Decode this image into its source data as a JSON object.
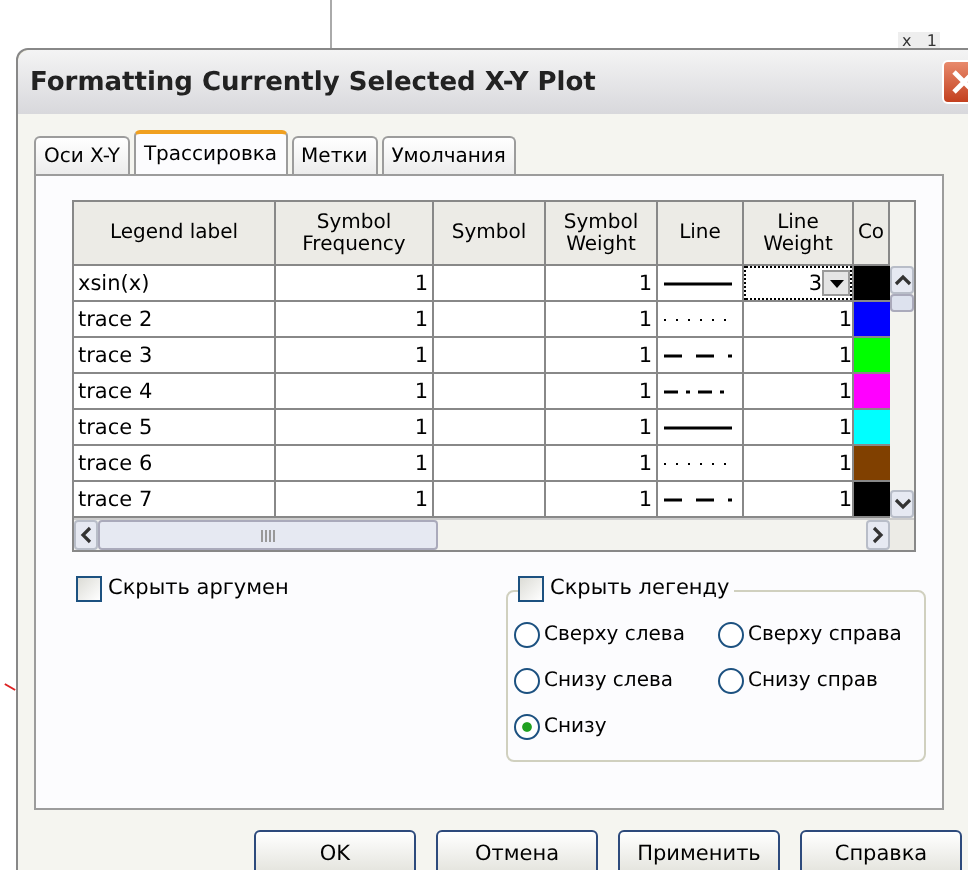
{
  "background": {
    "corner_text": "x   1"
  },
  "window": {
    "title": "Formatting Currently Selected X-Y Plot"
  },
  "tabs": [
    {
      "label": "Оси X-Y",
      "selected": false
    },
    {
      "label": "Трассировка",
      "selected": true
    },
    {
      "label": "Метки",
      "selected": false
    },
    {
      "label": "Умолчания",
      "selected": false
    }
  ],
  "table": {
    "columns": [
      "Legend label",
      "Symbol Frequency",
      "Symbol",
      "Symbol Weight",
      "Line",
      "Line Weight",
      "Co"
    ],
    "rows": [
      {
        "legend_label": "xsin(x)",
        "symbol_frequency": "1",
        "symbol_weight": "1",
        "kind": "solid",
        "line_weight": "3",
        "editing": true,
        "color": "#000000"
      },
      {
        "legend_label": "trace 2",
        "symbol_frequency": "1",
        "symbol_weight": "1",
        "kind": "dotted",
        "line_weight": "1",
        "editing": false,
        "color": "#0000ff"
      },
      {
        "legend_label": "trace 3",
        "symbol_frequency": "1",
        "symbol_weight": "1",
        "kind": "dashed",
        "line_weight": "1",
        "editing": false,
        "color": "#00ff00"
      },
      {
        "legend_label": "trace 4",
        "symbol_frequency": "1",
        "symbol_weight": "1",
        "kind": "dashdot",
        "line_weight": "1",
        "editing": false,
        "color": "#ff00ff"
      },
      {
        "legend_label": "trace 5",
        "symbol_frequency": "1",
        "symbol_weight": "1",
        "kind": "solid",
        "line_weight": "1",
        "editing": false,
        "color": "#00ffff"
      },
      {
        "legend_label": "trace 6",
        "symbol_frequency": "1",
        "symbol_weight": "1",
        "kind": "dotted",
        "line_weight": "1",
        "editing": false,
        "color": "#804000"
      },
      {
        "legend_label": "trace 7",
        "symbol_frequency": "1",
        "symbol_weight": "1",
        "kind": "dashed",
        "line_weight": "1",
        "editing": false,
        "color": "#000000"
      }
    ]
  },
  "hide_argument": {
    "label": "Скрыть аргумен",
    "checked": false
  },
  "legend": {
    "hide": {
      "label": "Скрыть легенду",
      "checked": false
    },
    "positions": [
      {
        "label": "Сверху слева",
        "selected": false
      },
      {
        "label": "Сверху справа",
        "selected": false
      },
      {
        "label": "Снизу слева",
        "selected": false
      },
      {
        "label": "Снизу справ",
        "selected": false
      },
      {
        "label": "Снизу",
        "selected": true
      }
    ]
  },
  "buttons": [
    "OK",
    "Отмена",
    "Применить",
    "Справка"
  ]
}
